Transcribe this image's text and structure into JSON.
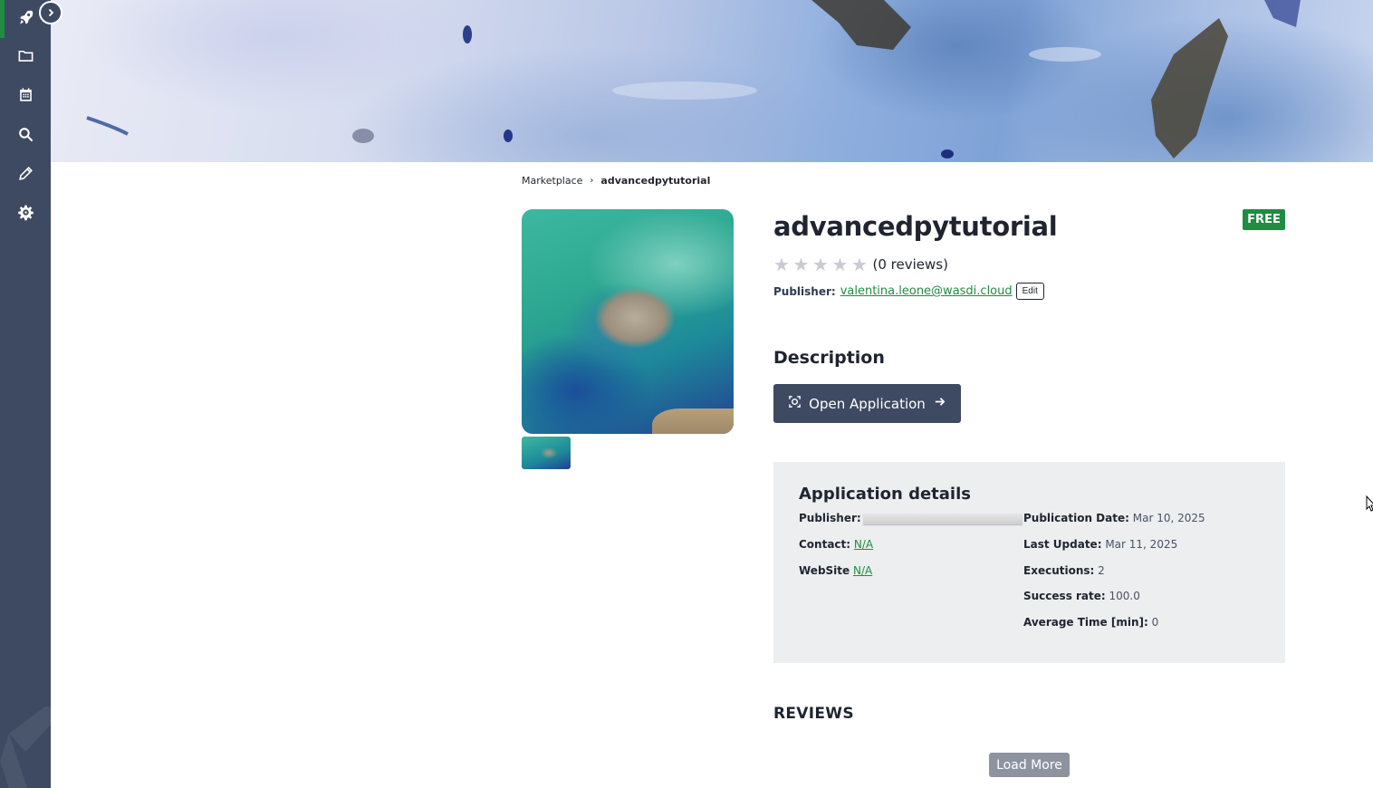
{
  "sidebar": {
    "items": [
      {
        "icon": "rocket-icon"
      },
      {
        "icon": "folder-icon"
      },
      {
        "icon": "calendar-icon"
      },
      {
        "icon": "search-icon"
      },
      {
        "icon": "pencil-icon"
      },
      {
        "icon": "gear-icon"
      }
    ],
    "toggle_icon": "chevron-right-circle-icon",
    "accent": "#1e8c43",
    "background": "#3e4a61"
  },
  "breadcrumb": {
    "root": "Marketplace",
    "separator": "›",
    "current": "advancedpytutorial"
  },
  "app": {
    "title": "advancedpytutorial",
    "badge": "FREE",
    "stars": 5,
    "rating": 0,
    "reviews_text": "(0 reviews)",
    "publisher_label": "Publisher:",
    "publisher_email": "valentina.leone@wasdi.cloud",
    "edit_label": "Edit"
  },
  "description": {
    "title": "Description",
    "open_button": "Open Application",
    "open_icon": "scan-icon",
    "arrow_icon": "arrow-right-icon"
  },
  "details": {
    "title": "Application details",
    "publisher_label": "Publisher:",
    "contact_label": "Contact:",
    "contact_value": "N/A",
    "website_label": "WebSite",
    "website_value": "N/A",
    "publication_date_label": "Publication Date:",
    "publication_date_value": "Mar 10, 2025",
    "last_update_label": "Last Update:",
    "last_update_value": "Mar 11, 2025",
    "executions_label": "Executions:",
    "executions_value": "2",
    "success_rate_label": "Success rate:",
    "success_rate_value": "100.0",
    "average_time_label": "Average Time [min]:",
    "average_time_value": "0"
  },
  "reviews": {
    "title": "REVIEWS",
    "load_more": "Load More"
  }
}
